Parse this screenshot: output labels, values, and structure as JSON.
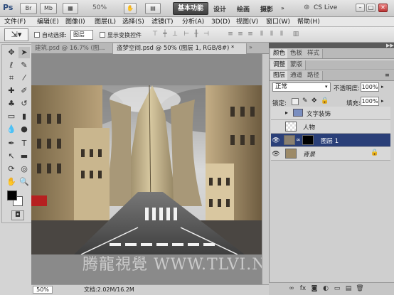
{
  "app": {
    "logo": "Ps",
    "zoom": "50%",
    "workspace_active": "基本功能",
    "workspaces": [
      "设计",
      "绘画",
      "摄影"
    ],
    "cslive": "CS Live"
  },
  "menu": [
    "文件(F)",
    "编辑(E)",
    "图像(I)",
    "图层(L)",
    "选择(S)",
    "滤镜(T)",
    "分析(A)",
    "3D(D)",
    "视图(V)",
    "窗口(W)",
    "帮助(H)"
  ],
  "options": {
    "auto_select": "自动选择:",
    "layer_select": "图层",
    "show_transform": "显示变换控件"
  },
  "tabs": [
    {
      "label": "建筑.psd @ 16.7% (图..."
    },
    {
      "label": "盗梦空间.psd @ 50% (图层 1, RGB/8#) *"
    }
  ],
  "status": {
    "zoom": "50%",
    "doc": "文档:2.02M/16.2M"
  },
  "panels": {
    "top_tabs": [
      "颜色",
      "色板",
      "样式"
    ],
    "mid_tabs": [
      "调整",
      "蒙版"
    ],
    "layer_tabs": [
      "图层",
      "通道",
      "路径"
    ],
    "blend_mode": "正常",
    "opacity_label": "不透明度:",
    "opacity": "100%",
    "lock_label": "锁定:",
    "fill_label": "填充:",
    "fill": "100%",
    "layers": [
      {
        "name": "文字装饰"
      },
      {
        "name": "人物"
      },
      {
        "name": "图层 1"
      },
      {
        "name": "背景"
      }
    ]
  },
  "watermark": "腾龍視覺 WWW.TLVI.NET",
  "colors": {
    "selected_layer": "#2a3f78",
    "workspace_btn": "#4a4a4a"
  }
}
